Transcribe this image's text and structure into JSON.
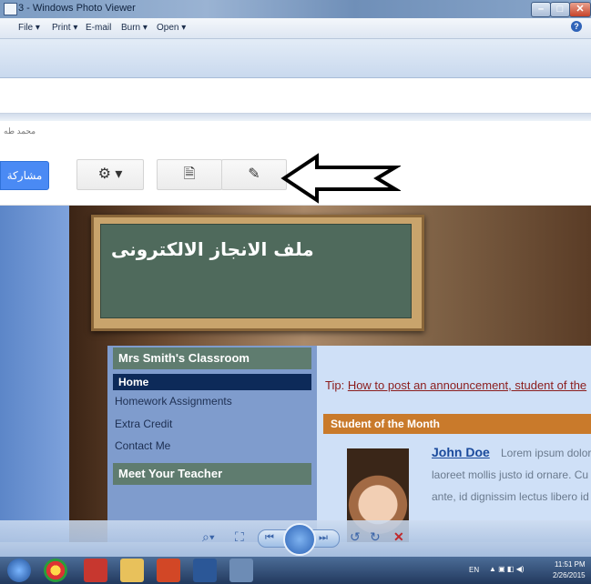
{
  "window": {
    "title": "3 - Windows Photo Viewer"
  },
  "menu": {
    "items": [
      "File ▾",
      "Print ▾",
      "E-mail",
      "Burn ▾",
      "Open ▾"
    ],
    "help": "?"
  },
  "site": {
    "small_text": "محمد طه",
    "share_label": "مشاركة",
    "board_title": "ملف الانجاز الالكترونى",
    "sidebar": {
      "header": "Mrs Smith's Classroom",
      "nav": [
        "Home",
        "Homework Assignments",
        "Extra Credit",
        "Contact Me"
      ],
      "active": "Home",
      "meet": "Meet Your Teacher"
    },
    "tip_prefix": "Tip: ",
    "tip_link": "How to post an announcement, student of the",
    "som_title": "Student of the Month",
    "student_name": "John Doe",
    "lorem_lines": [
      " Lorem ipsum dolor",
      "laoreet mollis justo id ornare. Cu",
      "ante, id dignissim lectus libero id"
    ]
  },
  "taskbar": {
    "lang": "EN",
    "time": "11:51 PM",
    "date": "2/26/2015"
  },
  "colors": {
    "accent": "#4a8af4",
    "board": "#4f6a5c",
    "som_bar": "#c97a2b"
  }
}
